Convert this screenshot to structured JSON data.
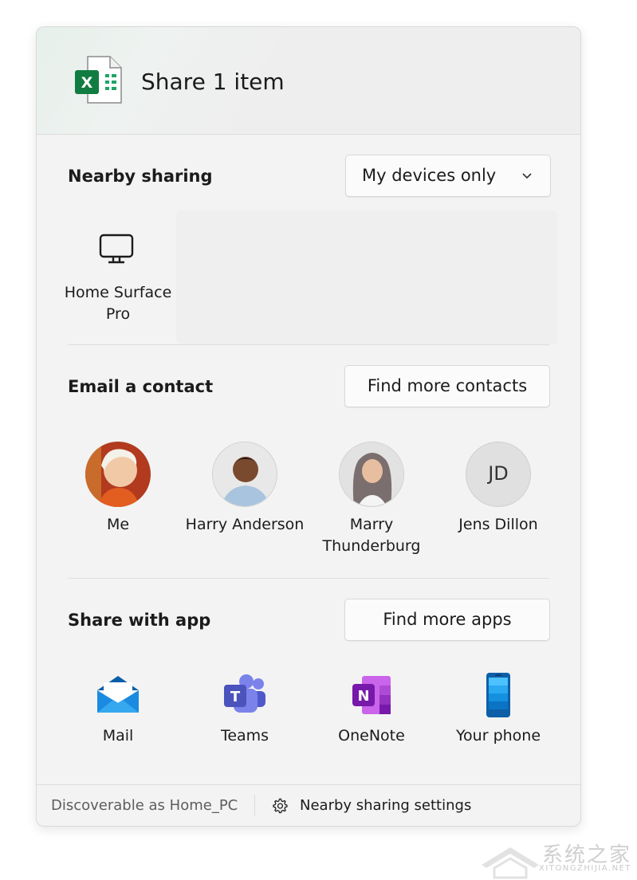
{
  "header": {
    "title": "Share 1 item",
    "file_icon_letter": "X"
  },
  "nearby": {
    "title": "Nearby sharing",
    "dropdown_value": "My devices only",
    "devices": [
      {
        "label": "Home Surface Pro",
        "icon": "monitor-icon"
      }
    ]
  },
  "email": {
    "title": "Email a contact",
    "find_button": "Find more contacts",
    "contacts": [
      {
        "name": "Me"
      },
      {
        "name": "Harry Anderson"
      },
      {
        "name": "Marry Thunderburg"
      },
      {
        "name": "Jens Dillon",
        "initials": "JD"
      }
    ]
  },
  "apps": {
    "title": "Share with app",
    "find_button": "Find more apps",
    "items": [
      {
        "name": "Mail",
        "icon": "mail-icon",
        "letter": ""
      },
      {
        "name": "Teams",
        "icon": "teams-icon",
        "letter": "T"
      },
      {
        "name": "OneNote",
        "icon": "onenote-icon",
        "letter": "N"
      },
      {
        "name": "Your phone",
        "icon": "phone-icon",
        "letter": ""
      }
    ]
  },
  "footer": {
    "discoverable": "Discoverable as Home_PC",
    "settings_label": "Nearby sharing settings"
  },
  "watermark": {
    "text": "系统之家",
    "sub": "XITONGZHIJIA.NET"
  },
  "colors": {
    "excel_green": "#107c41",
    "teams_purple": "#5b5fc7",
    "onenote_purple": "#7719aa",
    "mail_blue": "#0f78d4",
    "phone_blue": "#1a9be0"
  }
}
